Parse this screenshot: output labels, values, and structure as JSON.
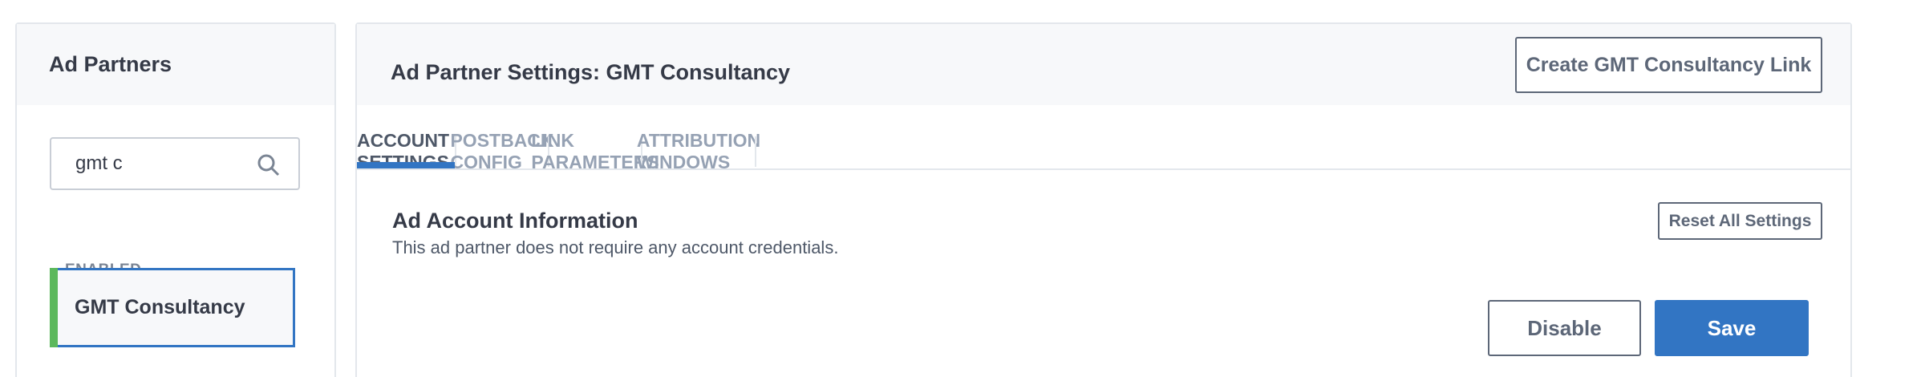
{
  "sidebar": {
    "title": "Ad Partners",
    "search": {
      "value": "gmt c",
      "icon": "search-icon"
    },
    "section_label": "ENABLED",
    "items": [
      {
        "label": "GMT Consultancy",
        "status_color": "#5cb85c",
        "selected": true
      }
    ]
  },
  "main": {
    "title": "Ad Partner Settings: GMT Consultancy",
    "create_link_label": "Create GMT Consultancy Link",
    "tabs": [
      {
        "label": "ACCOUNT SETTINGS",
        "active": true
      },
      {
        "label": "POSTBACK CONFIG",
        "active": false
      },
      {
        "label": "LINK PARAMETERS",
        "active": false
      },
      {
        "label": "ATTRIBUTION WINDOWS",
        "active": false
      }
    ],
    "section": {
      "title": "Ad Account Information",
      "description": "This ad partner does not require any account credentials.",
      "reset_label": "Reset All Settings"
    },
    "disable_label": "Disable",
    "save_label": "Save"
  },
  "colors": {
    "accent": "#3275c3",
    "enabled": "#5cb85c",
    "text": "#353a47"
  }
}
